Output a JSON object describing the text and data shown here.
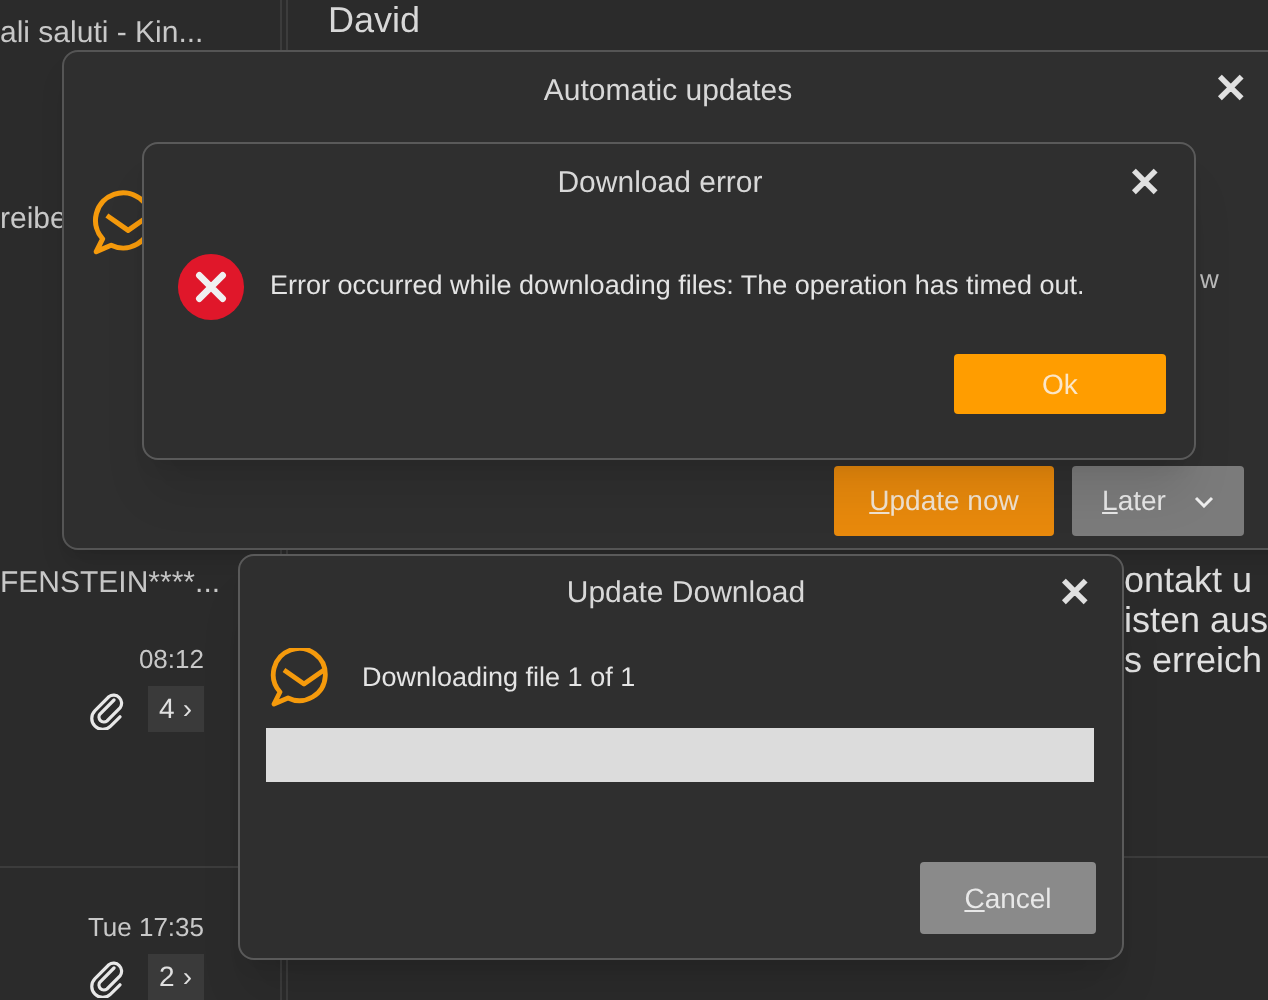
{
  "background": {
    "message_list": [
      {
        "subject": "ali saluti - Kin..."
      },
      {
        "subject": "reibe"
      },
      {
        "subject": "FENSTEIN****...",
        "time": "08:12",
        "count": "4",
        "chevron": "›",
        "attachment": true
      },
      {
        "time": "Tue 17:35",
        "count": "2",
        "chevron": "›",
        "attachment": true
      }
    ],
    "reading_pane": {
      "sender": "David",
      "lines": [
        "ontakt u",
        "isten aus",
        "s erreich"
      ]
    }
  },
  "automatic_updates": {
    "title": "Automatic updates",
    "message_fragment": "w",
    "close": "✕",
    "buttons": [
      {
        "label": "Update now",
        "kind": "primary"
      },
      {
        "label": "Later",
        "kind": "split"
      }
    ]
  },
  "download_error": {
    "title": "Download error",
    "close": "✕",
    "message": "Error occurred while downloading files: The operation has timed out.",
    "button": "Ok"
  },
  "update_download": {
    "title": "Update Download",
    "close": "✕",
    "status": "Downloading file 1 of 1",
    "progress": {
      "level": 1
    },
    "button": "Cancel"
  }
}
